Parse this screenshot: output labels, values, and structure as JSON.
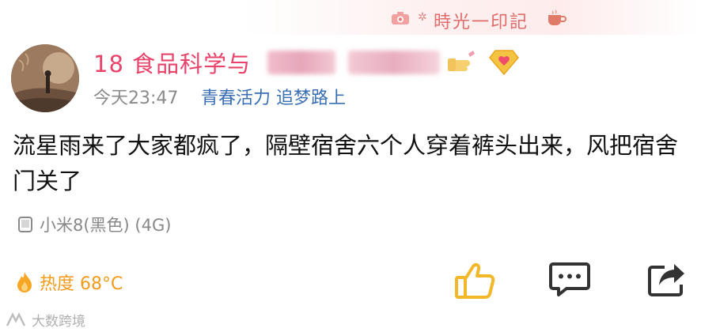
{
  "decor": {
    "banner_text": "時光一印記"
  },
  "post": {
    "username_prefix": "18 食品科学与",
    "time": "今天23:47",
    "source": "青春活力 追梦路上",
    "text": "流星雨来了大家都疯了，隔壁宿舍六个人穿着裤头出来，风把宿舍门关了",
    "device": "小米8(黑色) (4G)",
    "heat": "热度 68°C"
  },
  "watermark": {
    "text": "大数跨境"
  },
  "colors": {
    "username": "#e8436a",
    "source": "#3a6fb6",
    "heat": "#f29a1a",
    "meta": "#8a8a8a"
  },
  "icons": [
    "camera-icon",
    "cup-icon",
    "flame-icon",
    "phone-icon",
    "thumbs-up-icon",
    "comment-icon",
    "share-icon",
    "diamond-badge-icon",
    "hand-badge-icon"
  ]
}
